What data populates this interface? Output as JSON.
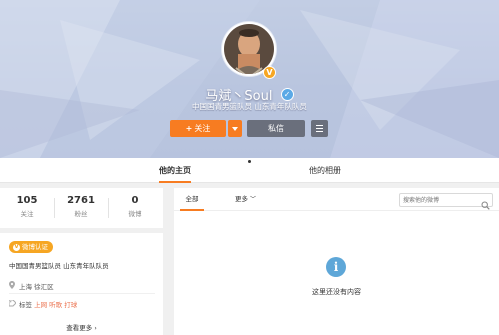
{
  "profile": {
    "name": "马斌丶Soul",
    "description": "中国国青男篮队员 山东青年队队员",
    "follow_label": "关注",
    "message_label": "私信",
    "avatar_icon": "avatar-image",
    "vip_icon": "verified-icon",
    "vip_glyph": "✓",
    "verified_glyph": "V"
  },
  "tabs": {
    "home": "他的主页",
    "album": "他的相册"
  },
  "stats": [
    {
      "value": "105",
      "label": "关注"
    },
    {
      "value": "2761",
      "label": "粉丝"
    },
    {
      "value": "0",
      "label": "微博"
    }
  ],
  "info": {
    "badge": "微博认证",
    "badge_glyph": "V",
    "verify_text": "中国国青男篮队员 山东青年队队员",
    "location": "上海 徐汇区",
    "tag_prefix": "标签",
    "tag_links": "上网 听歌 打球",
    "see_more": "查看更多",
    "see_more_arrow": "›"
  },
  "feed": {
    "all_label": "全部",
    "more_label": "更多",
    "more_chevron": "﹀",
    "search_placeholder": "搜索他的微博",
    "empty_glyph": "i",
    "empty_text": "这里还没有内容"
  },
  "colors": {
    "accent": "#f77c21",
    "gray_button": "#6a6f7c",
    "verified": "#f6a623",
    "info_icon": "#5ea7d8"
  }
}
